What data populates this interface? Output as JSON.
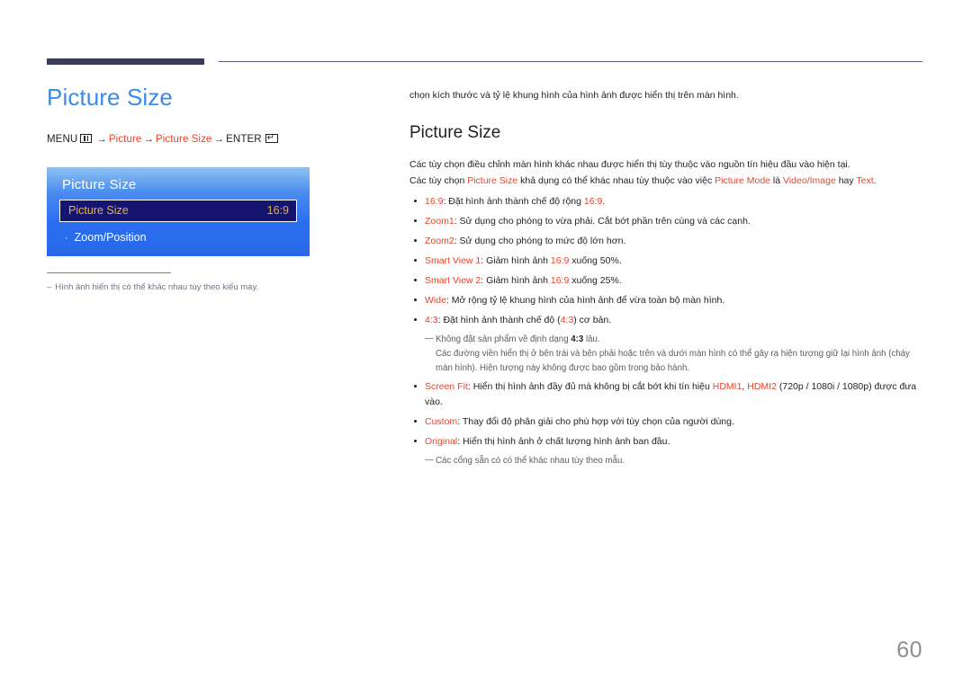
{
  "document": {
    "page_number": "60"
  },
  "left": {
    "title": "Picture Size",
    "breadcrumb": {
      "menu_label": "MENU",
      "menu_icon": "menu-grid-icon",
      "arrow": "→",
      "item1": "Picture",
      "item2": "Picture Size",
      "enter_label": "ENTER",
      "enter_icon": "enter-return-icon",
      "enter_glyph": "↵"
    },
    "osd": {
      "title": "Picture Size",
      "selected_row": {
        "label": "Picture Size",
        "value": "16:9"
      },
      "sub_row": {
        "bullet": "·",
        "label": "Zoom/Position"
      }
    },
    "note": {
      "dash": "–",
      "text": "Hình ảnh hiển thị có thể khác nhau tùy theo kiểu máy."
    }
  },
  "right": {
    "intro": "chọn kích thước và tỷ lệ khung hình của hình ảnh được hiển thị trên màn hình.",
    "section_title": "Picture Size",
    "paragraph1": "Các tùy chọn điều chỉnh màn hình khác nhau được hiển thị tùy thuộc vào nguồn tín hiệu đầu vào hiện tại.",
    "paragraph2": {
      "part1": "Các tùy chọn ",
      "term1": "Picture Size",
      "part2": " khả dụng có thể khác nhau tùy thuộc vào việc ",
      "term2": "Picture Mode",
      "part3": " là ",
      "term3": "Video/Image",
      "part4": " hay ",
      "term4": "Text",
      "part5": "."
    },
    "bullets": [
      {
        "term": "16:9",
        "text_before": ": Đặt hình ảnh thành chế độ rộng ",
        "term_inline": "16:9",
        "text_after": "."
      },
      {
        "term": "Zoom1",
        "text_before": ": Sử dụng cho phóng to vừa phải. Cắt bớt phần trên cùng và các cạnh.",
        "term_inline": "",
        "text_after": ""
      },
      {
        "term": "Zoom2",
        "text_before": ": Sử dụng cho phóng to mức độ lớn hơn.",
        "term_inline": "",
        "text_after": ""
      },
      {
        "term": "Smart View 1",
        "text_before": ": Giảm hình ảnh ",
        "term_inline": "16:9",
        "text_after": " xuống 50%."
      },
      {
        "term": "Smart View 2",
        "text_before": ": Giảm hình ảnh ",
        "term_inline": "16:9",
        "text_after": " xuống 25%."
      },
      {
        "term": "Wide",
        "text_before": ": Mở rộng tỷ lệ khung hình của hình ảnh để vừa toàn bộ màn hình.",
        "term_inline": "",
        "text_after": ""
      },
      {
        "term": "4:3",
        "text_before": ": Đặt hình ảnh thành chế độ (",
        "term_inline": "4:3",
        "text_after": ") cơ bản."
      }
    ],
    "subnote1": {
      "em_dash": "—",
      "line1_part1": "Không đặt sản phẩm về định dạng ",
      "line1_bold": "4:3",
      "line1_part2": " lâu.",
      "line2": "Các đường viền hiển thị ở bên trái và bên phải hoặc trên và dưới màn hình có thể gây ra hiện tượng giữ lại hình ảnh (cháy màn hình). Hiện tượng này không được bao gồm trong bảo hành."
    },
    "bullets2": [
      {
        "term": "Screen Fit",
        "text_before": ": Hiển thị hình ảnh đầy đủ mà không bị cắt bớt khi tín hiệu ",
        "term_inline": "HDMI1",
        "text_mid": ", ",
        "term_inline2": "HDMI2",
        "text_after": " (720p / 1080i / 1080p) được đưa vào."
      },
      {
        "term": "Custom",
        "text_before": ": Thay đổi độ phân giải cho phù hợp với tùy chọn của người dùng.",
        "term_inline": "",
        "text_mid": "",
        "term_inline2": "",
        "text_after": ""
      },
      {
        "term": "Original",
        "text_before": ": Hiển thị hình ảnh ở chất lượng hình ảnh ban đầu.",
        "term_inline": "",
        "text_mid": "",
        "term_inline2": "",
        "text_after": ""
      }
    ],
    "subnote2": {
      "em_dash": "—",
      "text": "Các cổng sẵn có có thể khác nhau tùy theo mẫu."
    }
  },
  "colors": {
    "title_blue": "#3d8ae8",
    "term_red": "#e8452c",
    "rule_navy": "#3b3b5c",
    "osd_highlight": "#151570",
    "osd_value_gold": "#e3b23c"
  }
}
